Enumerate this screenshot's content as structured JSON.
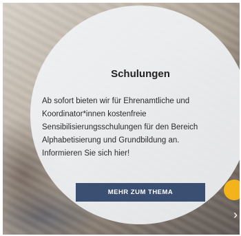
{
  "teaser": {
    "title": "Schulungen",
    "text": "Ab sofort bieten wir für Ehrenamtliche und Koordinator*innen kostenfreie Sensibilisierungsschulungen für den Bereich Alphabetisierung und Grundbildung an. Informieren Sie sich hier!",
    "cta_label": "MEHR ZUM THEMA",
    "next_glyph": "›"
  },
  "colors": {
    "button": "#3b4f73",
    "accent_dot": "#f3b41b",
    "circle_overlay": "#f2f4f7"
  }
}
